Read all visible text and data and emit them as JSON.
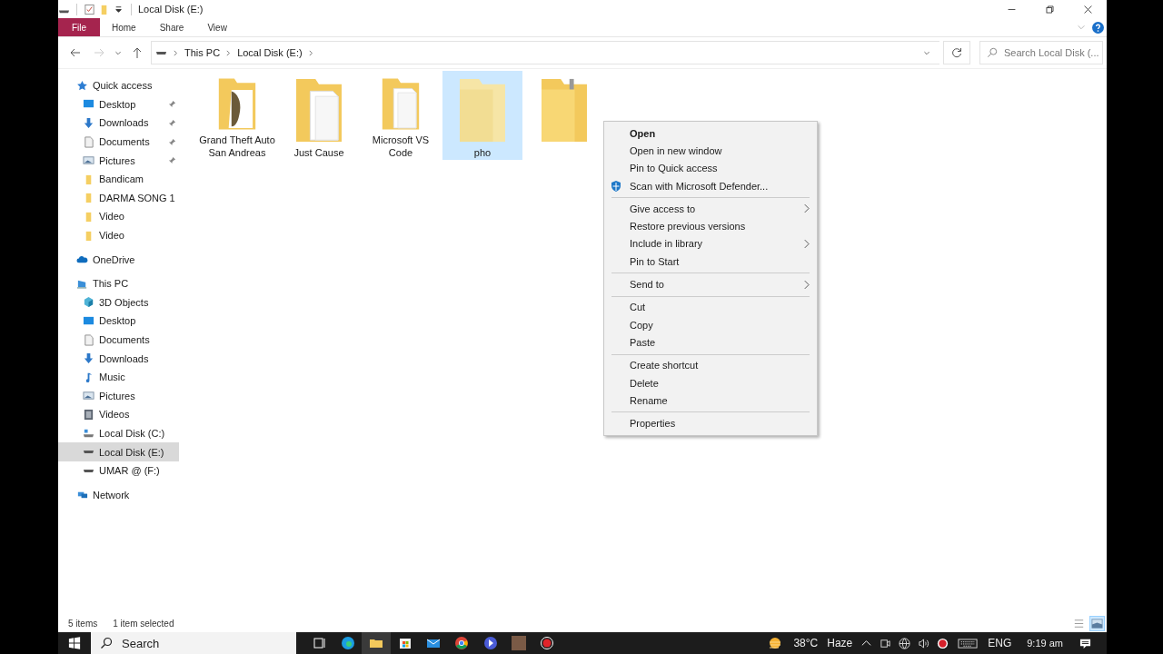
{
  "window": {
    "title": "Local Disk (E:)"
  },
  "ribbon_tabs": [
    {
      "label": "File",
      "kind": "file"
    },
    {
      "label": "Home",
      "kind": "tab"
    },
    {
      "label": "Share",
      "kind": "tab"
    },
    {
      "label": "View",
      "kind": "tab"
    }
  ],
  "address_bar": {
    "path": [
      "This PC",
      "Local Disk (E:)"
    ]
  },
  "search": {
    "placeholder": "Search Local Disk (..."
  },
  "sidebar": {
    "items": [
      {
        "label": "Quick access",
        "kind": "star",
        "selected": false,
        "children": [
          {
            "label": "Desktop",
            "kind": "desktop",
            "pinned": true,
            "selected": false
          },
          {
            "label": "Downloads",
            "kind": "download",
            "pinned": true,
            "selected": false
          },
          {
            "label": "Documents",
            "kind": "document",
            "pinned": true,
            "selected": false
          },
          {
            "label": "Pictures",
            "kind": "pictures",
            "pinned": true,
            "selected": false
          },
          {
            "label": "Bandicam",
            "kind": "folder",
            "pinned": false,
            "selected": false
          },
          {
            "label": "DARMA SONG 1",
            "kind": "folder",
            "pinned": false,
            "selected": false
          },
          {
            "label": "Video",
            "kind": "folder",
            "pinned": false,
            "selected": false
          },
          {
            "label": "Video",
            "kind": "folder",
            "pinned": false,
            "selected": false
          }
        ]
      },
      {
        "label": "OneDrive",
        "kind": "cloud",
        "selected": false
      },
      {
        "label": "This PC",
        "kind": "pc",
        "selected": false,
        "children": [
          {
            "label": "3D Objects",
            "kind": "cube",
            "pinned": false,
            "selected": false
          },
          {
            "label": "Desktop",
            "kind": "desktop",
            "pinned": false,
            "selected": false
          },
          {
            "label": "Documents",
            "kind": "document",
            "pinned": false,
            "selected": false
          },
          {
            "label": "Downloads",
            "kind": "download",
            "pinned": false,
            "selected": false
          },
          {
            "label": "Music",
            "kind": "music",
            "pinned": false,
            "selected": false
          },
          {
            "label": "Pictures",
            "kind": "pictures",
            "pinned": false,
            "selected": false
          },
          {
            "label": "Videos",
            "kind": "video",
            "pinned": false,
            "selected": false
          },
          {
            "label": "Local Disk (C:)",
            "kind": "system-drive",
            "pinned": false,
            "selected": false
          },
          {
            "label": "Local Disk (E:)",
            "kind": "drive",
            "pinned": false,
            "selected": true
          },
          {
            "label": "UMAR @  (F:)",
            "kind": "drive",
            "pinned": false,
            "selected": false
          }
        ]
      },
      {
        "label": "Network",
        "kind": "network",
        "selected": false
      }
    ]
  },
  "files": [
    {
      "name": "Grand Theft Auto San Andreas",
      "kind": "image",
      "selected": false
    },
    {
      "name": "Just Cause",
      "kind": "documents",
      "selected": false
    },
    {
      "name": "Microsoft VS Code",
      "kind": "documents",
      "selected": false
    },
    {
      "name": "pho",
      "kind": "plain",
      "selected": true
    },
    {
      "kind": "zip",
      "selected": false
    }
  ],
  "context_menu": {
    "items": [
      {
        "kind": "item",
        "label": "Open",
        "default": true,
        "submenu": false
      },
      {
        "kind": "item",
        "label": "Open in new window",
        "default": false,
        "submenu": false
      },
      {
        "kind": "item",
        "label": "Pin to Quick access",
        "default": false,
        "submenu": false
      },
      {
        "kind": "scan",
        "label": "Scan with Microsoft Defender...",
        "default": false,
        "submenu": false
      },
      {
        "kind": "separator"
      },
      {
        "kind": "item",
        "label": "Give access to",
        "default": false,
        "submenu": true
      },
      {
        "kind": "item",
        "label": "Restore previous versions",
        "default": false,
        "submenu": false
      },
      {
        "kind": "item",
        "label": "Include in library",
        "default": false,
        "submenu": true
      },
      {
        "kind": "item",
        "label": "Pin to Start",
        "default": false,
        "submenu": false
      },
      {
        "kind": "separator"
      },
      {
        "kind": "item",
        "label": "Send to",
        "default": false,
        "submenu": true
      },
      {
        "kind": "separator"
      },
      {
        "kind": "item",
        "label": "Cut",
        "default": false,
        "submenu": false
      },
      {
        "kind": "item",
        "label": "Copy",
        "default": false,
        "submenu": false
      },
      {
        "kind": "item",
        "label": "Paste",
        "default": false,
        "submenu": false
      },
      {
        "kind": "separator"
      },
      {
        "kind": "item",
        "label": "Create shortcut",
        "default": false,
        "submenu": false
      },
      {
        "kind": "item",
        "label": "Delete",
        "default": false,
        "submenu": false
      },
      {
        "kind": "item",
        "label": "Rename",
        "default": false,
        "submenu": false
      },
      {
        "kind": "separator"
      },
      {
        "kind": "item",
        "label": "Properties",
        "default": false,
        "submenu": false
      }
    ]
  },
  "status_bar": {
    "item_count": "5 items",
    "selection": "1 item selected"
  },
  "taskbar": {
    "search": {
      "placeholder": "Search"
    },
    "weather": {
      "temperature": "38°C",
      "condition": "Haze"
    },
    "language": "ENG",
    "time": "9:19 am"
  }
}
